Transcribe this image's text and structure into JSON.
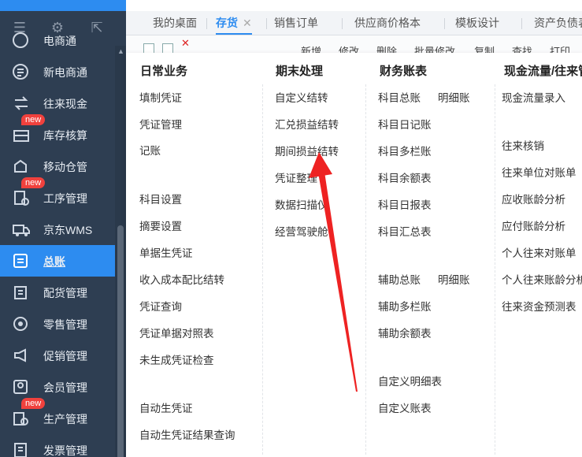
{
  "tabs": [
    "我的桌面",
    "存货",
    "销售订单",
    "供应商价格本",
    "模板设计",
    "资产负债表"
  ],
  "toolbar": [
    "新增",
    "修改",
    "删除",
    "批量修改",
    "复制",
    "查找",
    "打印"
  ],
  "sidebar": {
    "items": [
      {
        "label": "电商通",
        "icon": "cart-icon",
        "badge": ""
      },
      {
        "label": "新电商通",
        "icon": "shop-icon",
        "badge": ""
      },
      {
        "label": "往来现金",
        "icon": "exchange-icon",
        "badge": ""
      },
      {
        "label": "库存核算",
        "icon": "inventory-icon",
        "badge": "new"
      },
      {
        "label": "移动仓管",
        "icon": "cloud-house-icon",
        "badge": ""
      },
      {
        "label": "工序管理",
        "icon": "process-icon",
        "badge": "new"
      },
      {
        "label": "京东WMS",
        "icon": "truck-icon",
        "badge": ""
      },
      {
        "label": "总账",
        "icon": "ledger-icon",
        "badge": "",
        "active": true
      },
      {
        "label": "配货管理",
        "icon": "distribution-icon",
        "badge": ""
      },
      {
        "label": "零售管理",
        "icon": "retail-icon",
        "badge": ""
      },
      {
        "label": "促销管理",
        "icon": "megaphone-icon",
        "badge": ""
      },
      {
        "label": "会员管理",
        "icon": "member-icon",
        "badge": ""
      },
      {
        "label": "生产管理",
        "icon": "production-icon",
        "badge": "new"
      },
      {
        "label": "发票管理",
        "icon": "invoice-icon",
        "badge": ""
      }
    ]
  },
  "menu": {
    "col1": {
      "title": "日常业务",
      "items": [
        "填制凭证",
        "凭证管理",
        "记账",
        "科目设置",
        "摘要设置",
        "单据生凭证",
        "收入成本配比结转",
        "凭证查询",
        "凭证单据对照表",
        "未生成凭证检查",
        "自动生凭证",
        "自动生凭证结果查询"
      ]
    },
    "col2": {
      "title": "期末处理",
      "items": [
        "自定义结转",
        "汇兑损益结转",
        "期间损益结转",
        "凭证整理",
        "数据扫描仪",
        "经营驾驶舱"
      ]
    },
    "col3": {
      "title": "财务账表",
      "items": [
        "科目总账",
        "明细账",
        "科目日记账",
        "科目多栏账",
        "科目余额表",
        "科目日报表",
        "科目汇总表",
        "辅助总账",
        "明细账",
        "辅助多栏账",
        "辅助余额表",
        "自定义明细表",
        "自定义账表"
      ]
    },
    "col4": {
      "title": "现金流量/往来管理",
      "items": [
        "现金流量录入",
        "往来核销",
        "往来单位对账单",
        "应收账龄分析",
        "应付账龄分析",
        "个人往来对账单",
        "个人往来账龄分析",
        "往来资金预测表"
      ]
    }
  },
  "colors": {
    "sidebar": "#2e3e52",
    "accent": "#2d8cf0",
    "badge": "#f0413d",
    "arrow": "#ee2222"
  }
}
